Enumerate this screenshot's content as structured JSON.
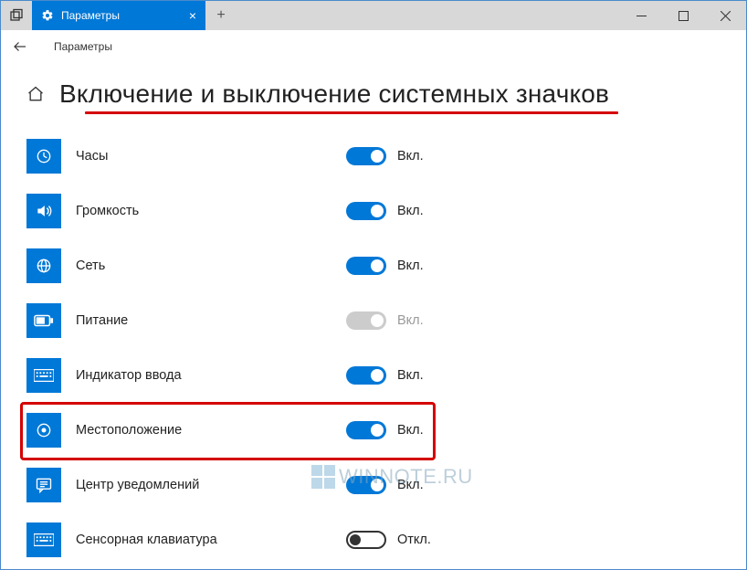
{
  "window": {
    "tab_title": "Параметры",
    "new_tab_label": "+"
  },
  "nav": {
    "title": "Параметры"
  },
  "page": {
    "header": "Включение и выключение системных значков"
  },
  "toggle_states": {
    "on": "Вкл.",
    "off": "Откл."
  },
  "items": [
    {
      "icon": "clock",
      "label": "Часы",
      "state": "on",
      "state_label": "Вкл.",
      "highlighted": false
    },
    {
      "icon": "volume",
      "label": "Громкость",
      "state": "on",
      "state_label": "Вкл.",
      "highlighted": false
    },
    {
      "icon": "network",
      "label": "Сеть",
      "state": "on",
      "state_label": "Вкл.",
      "highlighted": false
    },
    {
      "icon": "power",
      "label": "Питание",
      "state": "disabled",
      "state_label": "Вкл.",
      "highlighted": false
    },
    {
      "icon": "keyboard",
      "label": "Индикатор ввода",
      "state": "on",
      "state_label": "Вкл.",
      "highlighted": false
    },
    {
      "icon": "location",
      "label": "Местоположение",
      "state": "on",
      "state_label": "Вкл.",
      "highlighted": true
    },
    {
      "icon": "action-ctr",
      "label": "Центр уведомлений",
      "state": "on",
      "state_label": "Вкл.",
      "highlighted": false
    },
    {
      "icon": "touch-kbd",
      "label": "Сенсорная клавиатура",
      "state": "off",
      "state_label": "Откл.",
      "highlighted": false
    }
  ],
  "watermark": "WINNOTE.RU",
  "colors": {
    "accent": "#0078d7",
    "annotation_red": "#d40000"
  }
}
